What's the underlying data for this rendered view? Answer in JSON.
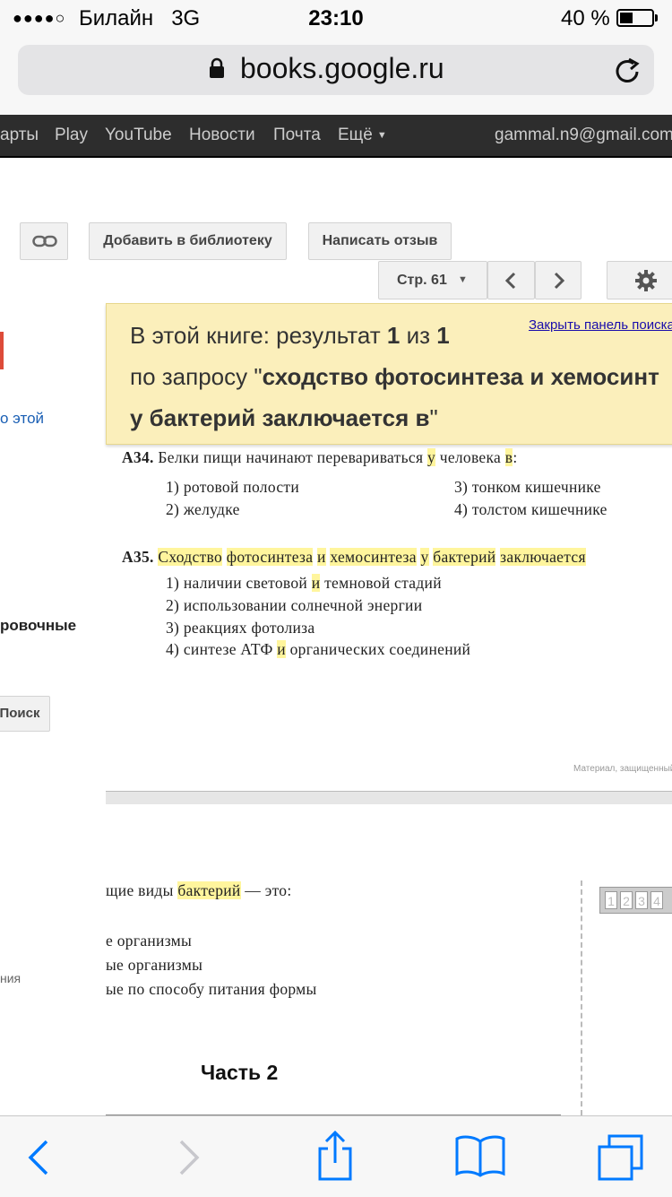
{
  "status_bar": {
    "signal": "●●●●○",
    "carrier": "Билайн",
    "network": "3G",
    "time": "23:10",
    "battery_text": "40 %",
    "battery_level": 0.4
  },
  "browser": {
    "url": "books.google.ru"
  },
  "google_nav": {
    "items": [
      "арты",
      "Play",
      "YouTube",
      "Новости",
      "Почта",
      "Ещё"
    ],
    "account": "gammal.n9@gmail.com"
  },
  "toolbar": {
    "add_to_library": "Добавить в библиотеку",
    "write_review": "Написать отзыв",
    "page_label": "Стр. 61"
  },
  "sidebar": {
    "link_partial": "о этой",
    "bold_partial": "ровочные",
    "search_button": "Поиск",
    "small_partial": "ния"
  },
  "result_panel": {
    "line1_pre": "В этой книге: результат ",
    "current": "1",
    "line1_mid": " из ",
    "total": "1",
    "line2_pre": "по запросу \"",
    "query_part1": "сходство фотосинтеза и хемосинт",
    "query_part2": "у бактерий заключается в",
    "line3_post": "\"",
    "close_link": "Закрыть панель поиска"
  },
  "book_page": {
    "a34": {
      "num": "А34.",
      "q_pre": "Белки пищи начинают перевариваться ",
      "q_hl1": "у",
      "q_mid": " человека ",
      "q_hl2": "в",
      "q_post": ":",
      "opt1": "1)  ротовой полости",
      "opt2": "2)  желудке",
      "opt3": "3)  тонком кишечнике",
      "opt4": "4)  толстом кишечнике"
    },
    "a35": {
      "num": "А35.",
      "w1": "Сходство",
      "w2": "фотосинтеза",
      "w3": "и",
      "w4": "хемосинтеза",
      "w5": "у",
      "w6": "бактерий",
      "w7": "заключается",
      "opt1_pre": "1)  наличии световой ",
      "opt1_hl": "и",
      "opt1_post": " темновой стадий",
      "opt2": "2)  использовании солнечной энергии",
      "opt3": "3)  реакциях фотолиза",
      "opt4_pre": "4)  синтезе АТФ ",
      "opt4_hl": "и",
      "opt4_post": " органических соединений"
    },
    "watermark": "Материал, защищенный"
  },
  "page2": {
    "line1_pre": "щие виды ",
    "line1_hl": "бактерий",
    "line1_post": " — это:",
    "line2": "е организмы",
    "line3": "ые организмы",
    "line4": "ые по способу питания формы",
    "heading": "Часть 2",
    "answer_boxes": [
      "1",
      "2",
      "3",
      "4"
    ]
  },
  "colors": {
    "highlight": "#fff59d",
    "panel_bg": "#fbefbb",
    "ios_blue": "#007aff",
    "nav_bg": "#2d2d2d"
  }
}
